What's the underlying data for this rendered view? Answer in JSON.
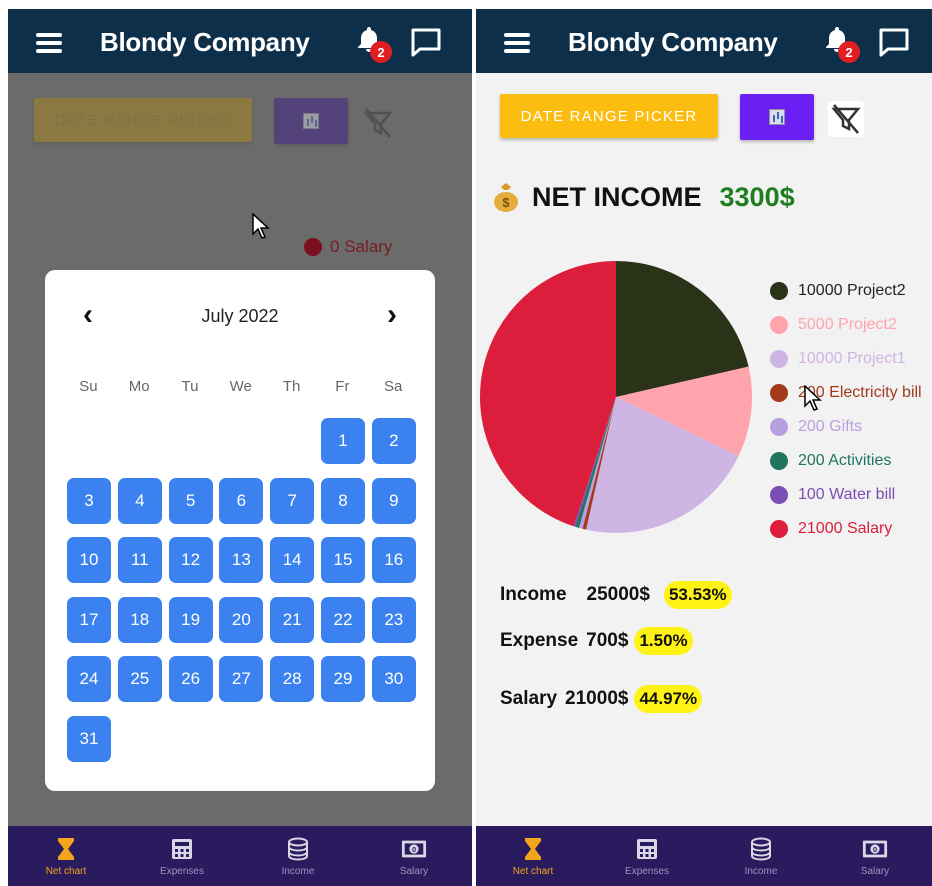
{
  "app": {
    "title": "Blondy Company",
    "notification_count": "2"
  },
  "toolbar": {
    "date_range_label": "DATE RANGE PICKER"
  },
  "calendar": {
    "month": "July 2022",
    "prev": "‹",
    "next": "›",
    "weekdays": [
      "Su",
      "Mo",
      "Tu",
      "We",
      "Th",
      "Fr",
      "Sa"
    ],
    "days": [
      "1",
      "2",
      "3",
      "4",
      "5",
      "6",
      "7",
      "8",
      "9",
      "10",
      "11",
      "12",
      "13",
      "14",
      "15",
      "16",
      "17",
      "18",
      "19",
      "20",
      "21",
      "22",
      "23",
      "24",
      "25",
      "26",
      "27",
      "28",
      "29",
      "30",
      "31"
    ],
    "first_weekday_index": 5
  },
  "background_legend": {
    "text": "0 Salary"
  },
  "net_income": {
    "label": "NET INCOME",
    "value": "3300$"
  },
  "chart_data": {
    "type": "pie",
    "slices": [
      {
        "label": "10000 Project2",
        "value": 10000,
        "color": "#2a3317"
      },
      {
        "label": "5000 Project2",
        "value": 5000,
        "color": "#ffa4ad"
      },
      {
        "label": "10000 Project1",
        "value": 10000,
        "color": "#cfb5e4"
      },
      {
        "label": "200 Electricity bill",
        "value": 200,
        "color": "#a33a1e"
      },
      {
        "label": "200 Gifts",
        "value": 200,
        "color": "#b89fe0"
      },
      {
        "label": "200 Activities",
        "value": 200,
        "color": "#1f7560"
      },
      {
        "label": "100 Water bill",
        "value": 100,
        "color": "#7a4fb5"
      },
      {
        "label": "21000 Salary",
        "value": 21000,
        "color": "#dc1e3c"
      }
    ],
    "legend_position": "right"
  },
  "stats": {
    "income_label": "Income",
    "income_value": "25000$",
    "income_pct": "53.53%",
    "expense_label": "Expense",
    "expense_value": "700$",
    "expense_pct": "1.50%",
    "salary_label": "Salary",
    "salary_value": "21000$",
    "salary_pct": "44.97%"
  },
  "nav": [
    {
      "label": "Net chart",
      "icon": "hourglass-icon",
      "active": true
    },
    {
      "label": "Expenses",
      "icon": "calculator-icon",
      "active": false
    },
    {
      "label": "Income",
      "icon": "database-icon",
      "active": false
    },
    {
      "label": "Salary",
      "icon": "money-icon",
      "active": false
    }
  ],
  "colors": {
    "appbar": "#0d2f4a",
    "nav": "#2a1a5e",
    "accent": "#fbbd10",
    "chart_button": "#6b1ff2",
    "day": "#3b82f0"
  }
}
